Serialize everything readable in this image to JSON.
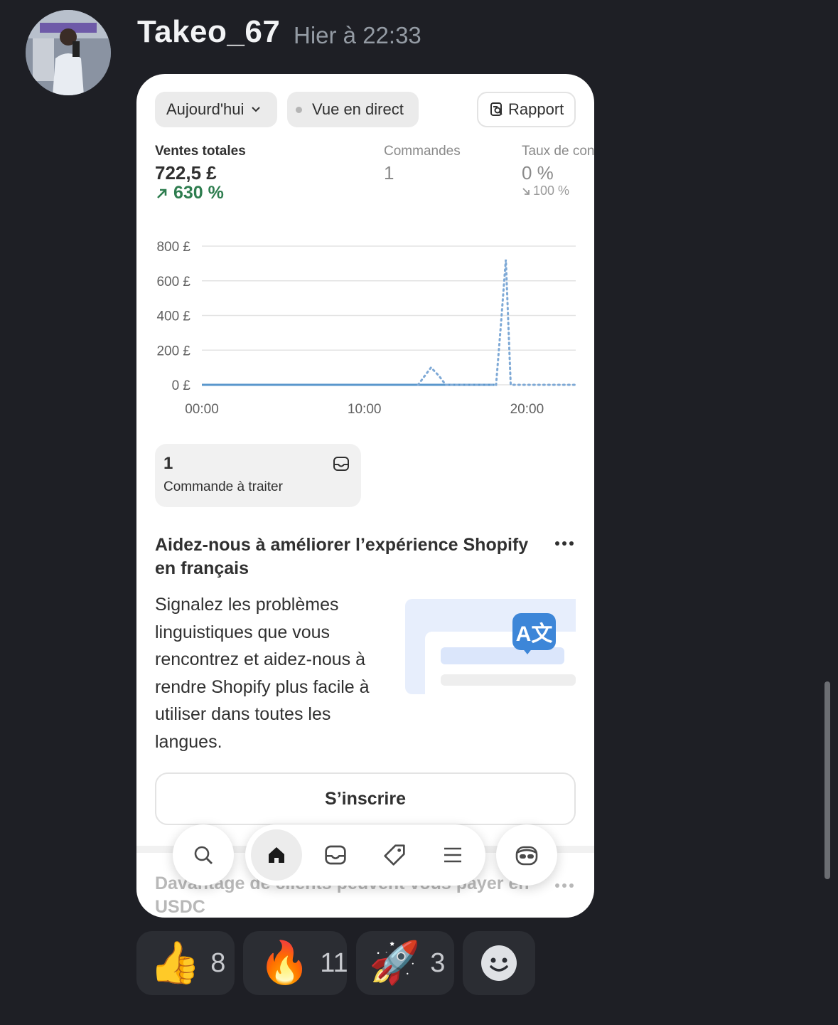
{
  "message": {
    "author": "Takeo_67",
    "timestamp": "Hier à 22:33"
  },
  "shopify": {
    "filters": {
      "date_label": "Aujourd'hui",
      "live_label": "Vue en direct",
      "report_label": "Rapport"
    },
    "metrics": [
      {
        "label": "Ventes totales",
        "value": "722,5 £",
        "change": "630 %",
        "change_dir": "up"
      },
      {
        "label": "Commandes",
        "value": "1"
      },
      {
        "label": "Taux de con",
        "value": "0 %",
        "change": "100 %",
        "change_dir": "down"
      }
    ],
    "chart_data": {
      "type": "line",
      "x_ticks": [
        "00:00",
        "10:00",
        "20:00"
      ],
      "y_ticks": [
        "800 £",
        "600 £",
        "400 £",
        "200 £",
        "0 £"
      ],
      "ylim": [
        0,
        800
      ],
      "xlim": [
        0,
        23
      ],
      "current_series": {
        "x": [
          0,
          1,
          2,
          3,
          4,
          5,
          6,
          7,
          8,
          9,
          10,
          11,
          12,
          13,
          14,
          15,
          16,
          17,
          18
        ],
        "y": [
          0,
          0,
          0,
          0,
          0,
          0,
          0,
          0,
          0,
          0,
          0,
          0,
          0,
          0,
          0,
          0,
          0,
          0,
          0
        ]
      },
      "comparison_series": {
        "x": [
          13.3,
          14.1,
          14.6,
          15,
          18.1,
          18.4,
          18.7,
          19,
          20,
          21,
          22,
          23
        ],
        "y": [
          0,
          100,
          50,
          0,
          0,
          350,
          722.5,
          0,
          0,
          0,
          0,
          0
        ]
      },
      "colors": {
        "current": "#5a97cc",
        "comparison": "#7ea9d6",
        "grid": "#e3e3e3"
      }
    },
    "order_card": {
      "count": "1",
      "label": "Commande à traiter"
    },
    "card": {
      "title": "Aidez-nous à améliorer l’expérience Shopify en français",
      "body": "Signalez les problèmes linguistiques que vous rencontrez et aidez-nous à rendre Shopify plus facile à utiliser dans toutes les langues.",
      "badge": "A文",
      "cta": "S’inscrire"
    },
    "next_card_title": "Davantage de clients peuvent vous payer en USDC",
    "nav_icons": [
      "search-icon",
      "home-icon",
      "inbox-icon",
      "tag-icon",
      "menu-icon",
      "sidekick-icon"
    ]
  },
  "reactions": [
    {
      "emoji": "👍",
      "count": "8"
    },
    {
      "emoji": "🔥",
      "count": "11"
    },
    {
      "emoji": "🚀",
      "count": "3"
    }
  ]
}
